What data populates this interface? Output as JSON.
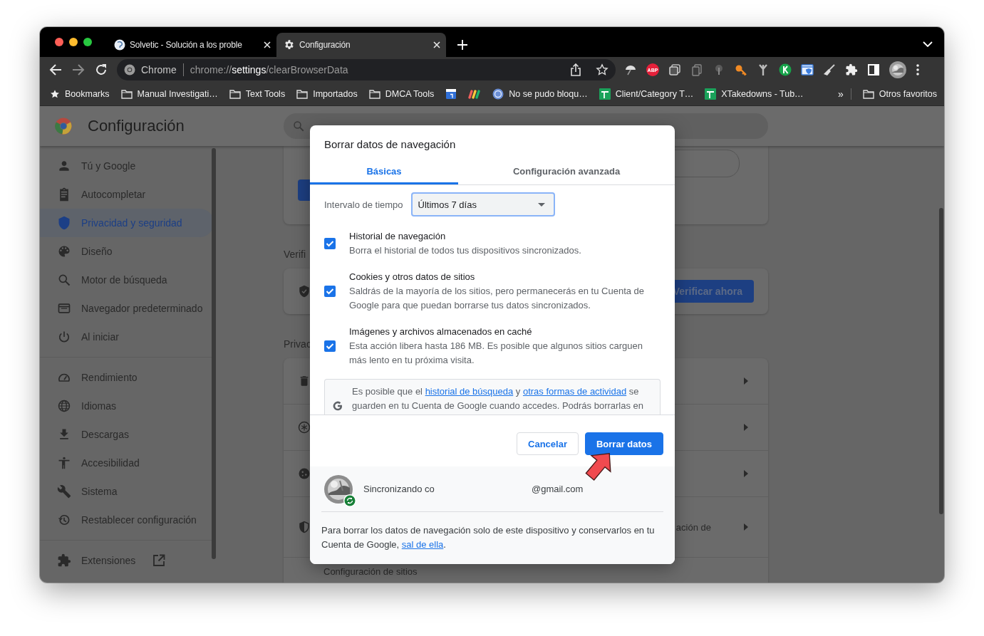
{
  "tabs": [
    {
      "title": "Solvetic - Solución a los proble",
      "kind": "site",
      "selected": false
    },
    {
      "title": "Configuración",
      "kind": "settings",
      "selected": true
    }
  ],
  "nav_buttons": [
    {
      "kind": "back",
      "disabled": false
    },
    {
      "kind": "forward",
      "disabled": true
    },
    {
      "kind": "reload",
      "disabled": false
    }
  ],
  "omnibox": {
    "origin": "Chrome",
    "scheme": "chrome://",
    "host": "settings",
    "path": "/clearBrowserData"
  },
  "extension_badge": "ABP",
  "bookmarks": [
    {
      "kind": "star",
      "label": "Bookmarks"
    },
    {
      "kind": "folder",
      "label": "Manual Investigati…"
    },
    {
      "kind": "folder",
      "label": "Text Tools"
    },
    {
      "kind": "folder",
      "label": "Importados"
    },
    {
      "kind": "folder",
      "label": "DMCA Tools"
    },
    {
      "kind": "calendar"
    },
    {
      "kind": "rainbow"
    },
    {
      "kind": "globe",
      "label": "No se pudo bloqu…"
    },
    {
      "kind": "sheet",
      "label": "Client/Category T…"
    },
    {
      "kind": "sheet",
      "label": "XTakedowns - Tub…"
    }
  ],
  "bookmarks_overflow": "»",
  "other_bookmarks": "Otros favoritos",
  "settings": {
    "title": "Configuración",
    "nav_sections": [
      {
        "items": [
          {
            "label": "Tú y Google",
            "selected": false
          },
          {
            "label": "Autocompletar",
            "selected": false
          },
          {
            "label": "Privacidad y seguridad",
            "selected": true
          },
          {
            "label": "Diseño",
            "selected": false
          },
          {
            "label": "Motor de búsqueda",
            "selected": false
          },
          {
            "label": "Navegador predeterminado",
            "selected": false
          },
          {
            "label": "Al iniciar",
            "selected": false
          }
        ]
      },
      {
        "items": [
          {
            "label": "Rendimiento",
            "selected": false
          },
          {
            "label": "Idiomas",
            "selected": false
          },
          {
            "label": "Descargas",
            "selected": false
          },
          {
            "label": "Accesibilidad",
            "selected": false
          },
          {
            "label": "Sistema",
            "selected": false
          },
          {
            "label": "Restablecer configuración",
            "selected": false
          }
        ]
      },
      {
        "items": [
          {
            "label": "Extensiones",
            "selected": false,
            "external": true
          }
        ]
      }
    ],
    "headings": [
      "Verifi",
      "Privac"
    ],
    "verify_button": "Verificar ahora",
    "row_fragment": "ación de",
    "last_row": "Configuración de sitios"
  },
  "dialog": {
    "title": "Borrar datos de navegación",
    "tabs": [
      {
        "label": "Básicas",
        "selected": true
      },
      {
        "label": "Configuración avanzada",
        "selected": false
      }
    ],
    "time_range": {
      "label": "Intervalo de tiempo",
      "value": "Últimos 7 días"
    },
    "options": [
      {
        "title": "Historial de navegación",
        "description": "Borra el historial de todos tus dispositivos sincronizados.",
        "checked": true
      },
      {
        "title": "Cookies y otros datos de sitios",
        "description": "Saldrás de la mayoría de los sitios, pero permanecerás en tu Cuenta de Google para que puedan borrarse tus datos sincronizados.",
        "checked": true
      },
      {
        "title": "Imágenes y archivos almacenados en caché",
        "description": "Esta acción libera hasta 186 MB. Es posible que algunos sitios carguen más lento en tu próxima visita.",
        "checked": true
      }
    ],
    "notice": [
      {
        "text": "Es posible que el "
      },
      {
        "text": "historial de búsqueda",
        "link": true
      },
      {
        "text": " y "
      },
      {
        "text": "otras formas de actividad",
        "link": true
      },
      {
        "text": " se guarden en tu Cuenta de Google cuando accedes. Podrás borrarlas en"
      }
    ],
    "buttons": [
      {
        "label": "Cancelar",
        "kind": "secondary"
      },
      {
        "label": "Borrar datos",
        "kind": "primary"
      }
    ],
    "account": {
      "status": "Sincronizando co",
      "email": "@gmail.com",
      "syncing": true
    },
    "footer_note": [
      {
        "text": "Para borrar los datos de navegación solo de este dispositivo y conservarlos en tu Cuenta de Google, "
      },
      {
        "text": "sal de ella",
        "link": true
      },
      {
        "text": "."
      }
    ]
  }
}
